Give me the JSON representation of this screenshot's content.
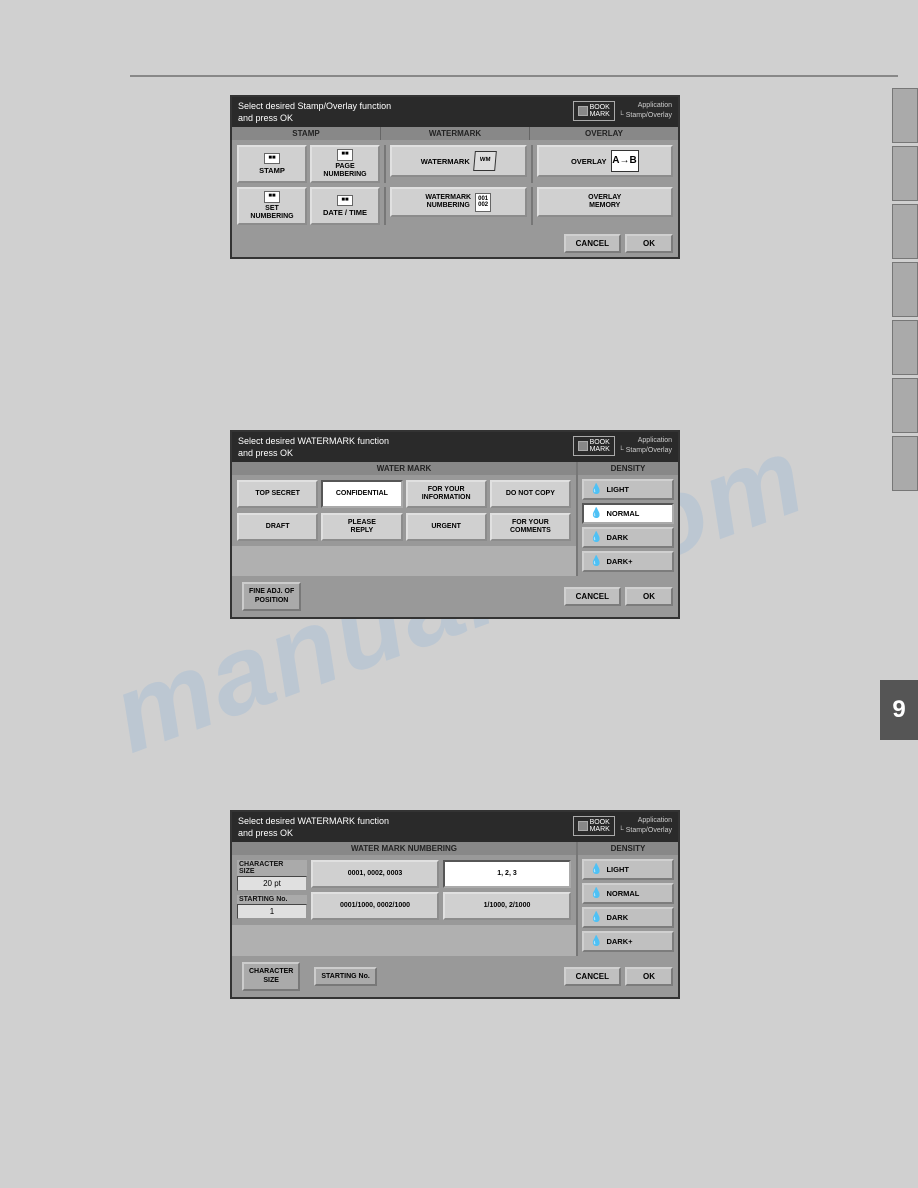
{
  "page": {
    "background_color": "#d0d0d0",
    "watermark": "manuals.com"
  },
  "top_rule": true,
  "right_tabs": [
    {
      "id": "tab1",
      "active": false
    },
    {
      "id": "tab2",
      "active": false
    },
    {
      "id": "tab3",
      "active": false
    },
    {
      "id": "tab4",
      "active": false
    },
    {
      "id": "tab5",
      "active": false
    },
    {
      "id": "tab6",
      "active": false
    },
    {
      "id": "tab7",
      "active": false
    },
    {
      "id": "tab8",
      "dark": true,
      "label": "9"
    }
  ],
  "panel1": {
    "header_line1": "Select desired Stamp/Overlay function",
    "header_line2": "and press OK",
    "bookmark_label": "BOOK\nMARK",
    "breadcrumb_line1": "Application",
    "breadcrumb_line2": "└ Stamp/Overlay",
    "sections": {
      "stamp_label": "STAMP",
      "watermark_label": "WATERMARK",
      "overlay_label": "OVERLAY"
    },
    "buttons": {
      "stamp": "STAMP",
      "page_numbering": "PAGE\nNUMBERING",
      "watermark": "WATERMARK",
      "overlay": "OVERLAY",
      "set_numbering": "SET\nNUMBERING",
      "date_time": "DATE / TIME",
      "watermark_numbering": "WATERMARK\nNUMBERING",
      "overlay_memory": "OVERLAY\nMEMORY"
    },
    "footer": {
      "cancel": "CANCEL",
      "ok": "OK"
    }
  },
  "panel2": {
    "header_line1": "Select desired WATERMARK function",
    "header_line2": "and press OK",
    "bookmark_label": "BOOK\nMARK",
    "breadcrumb_line1": "Application",
    "breadcrumb_line2": "└ Stamp/Overlay",
    "watermark_section_label": "WATER MARK",
    "density_section_label": "DENSITY",
    "watermark_buttons": [
      {
        "id": "top_secret",
        "label": "TOP SECRET"
      },
      {
        "id": "confidential",
        "label": "CONFIDENTIAL",
        "selected": true
      },
      {
        "id": "for_your_info",
        "label": "FOR YOUR\nINFORMATION"
      },
      {
        "id": "do_not_copy",
        "label": "DO NOT COPY"
      },
      {
        "id": "draft",
        "label": "DRAFT"
      },
      {
        "id": "please_reply",
        "label": "PLEASE\nREPLY"
      },
      {
        "id": "urgent",
        "label": "URGENT"
      },
      {
        "id": "for_your_comments",
        "label": "FOR YOUR\nCOMMENTS"
      }
    ],
    "density_buttons": [
      {
        "id": "light",
        "label": "LIGHT"
      },
      {
        "id": "normal",
        "label": "NORMAL",
        "selected": true
      },
      {
        "id": "dark",
        "label": "DARK"
      },
      {
        "id": "dark_plus",
        "label": "DARK+"
      }
    ],
    "fine_adj": "FINE ADJ. OF\nPOSITION",
    "footer": {
      "cancel": "CANCEL",
      "ok": "OK"
    }
  },
  "panel3": {
    "header_line1": "Select desired WATERMARK function",
    "header_line2": "and press OK",
    "bookmark_label": "BOOK\nMARK",
    "breadcrumb_line1": "Application",
    "breadcrumb_line2": "└ Stamp/Overlay",
    "section_label": "WATER MARK NUMBERING",
    "density_section_label": "DENSITY",
    "character_size_label": "CHARACTER\nSIZE",
    "character_size_value": "20 pt",
    "starting_no_label": "STARTING No.",
    "starting_no_value": "1",
    "numbering_options_row1": [
      "0001, 0002, 0003",
      "1, 2, 3"
    ],
    "numbering_options_row2": [
      "0001/1000, 0002/1000",
      "1/1000, 2/1000"
    ],
    "density_buttons": [
      {
        "id": "light",
        "label": "LIGHT"
      },
      {
        "id": "normal",
        "label": "NORMAL"
      },
      {
        "id": "dark",
        "label": "DARK"
      },
      {
        "id": "dark_plus",
        "label": "DARK+"
      }
    ],
    "footer_buttons": {
      "character_size": "CHARACTER\nSIZE",
      "starting_no": "STARTING No.",
      "cancel": "CANCEL",
      "ok": "OK"
    }
  }
}
